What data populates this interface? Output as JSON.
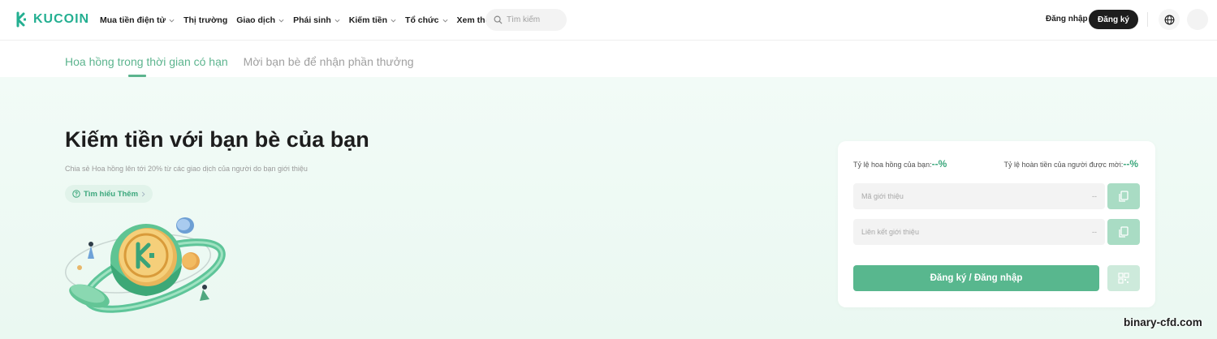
{
  "header": {
    "logo_text": "KUCOIN",
    "nav": [
      {
        "label": "Mua tiền điện tử",
        "has_dropdown": true
      },
      {
        "label": "Thị trường",
        "has_dropdown": false
      },
      {
        "label": "Giao dịch",
        "has_dropdown": true
      },
      {
        "label": "Phái sinh",
        "has_dropdown": true
      },
      {
        "label": "Kiếm tiền",
        "has_dropdown": true
      },
      {
        "label": "Tổ chức",
        "has_dropdown": true
      },
      {
        "label": "Xem thêm",
        "has_dropdown": true
      }
    ],
    "search_placeholder": "Tìm kiếm",
    "login_label": "Đăng nhập",
    "signup_label": "Đăng ký"
  },
  "tabs": [
    {
      "label": "Hoa hồng trong thời gian có hạn",
      "active": true
    },
    {
      "label": "Mời bạn bè để nhận phần thưởng",
      "active": false
    }
  ],
  "hero": {
    "title": "Kiếm tiền với bạn bè của bạn",
    "subtitle": "Chia sẻ Hoa hồng lên tới 20% từ các giao dịch của người do bạn giới thiệu",
    "learn_more": "Tìm hiểu Thêm"
  },
  "card": {
    "commission_rate_label": "Tỷ lệ hoa hồng của bạn:",
    "commission_rate_value": "--%",
    "cashback_rate_label": "Tỷ lệ hoàn tiền của người được mời:",
    "cashback_rate_value": "--%",
    "referral_code_label": "Mã giới thiệu",
    "referral_code_value": "--",
    "referral_link_label": "Liên kết giới thiệu",
    "referral_link_value": "--",
    "cta_label": "Đăng ký / Đăng nhập"
  },
  "watermark": "binary-cfd.com",
  "colors": {
    "brand": "#23af91",
    "accent": "#58b78e",
    "hero_bg": "#eaf8f1",
    "dark": "#1d1d1d"
  },
  "icons": [
    "kucoin-logo-icon",
    "chevron-down-icon",
    "search-icon",
    "globe-icon",
    "help-circle-icon",
    "chevron-right-icon",
    "copy-icon",
    "qr-code-icon"
  ]
}
